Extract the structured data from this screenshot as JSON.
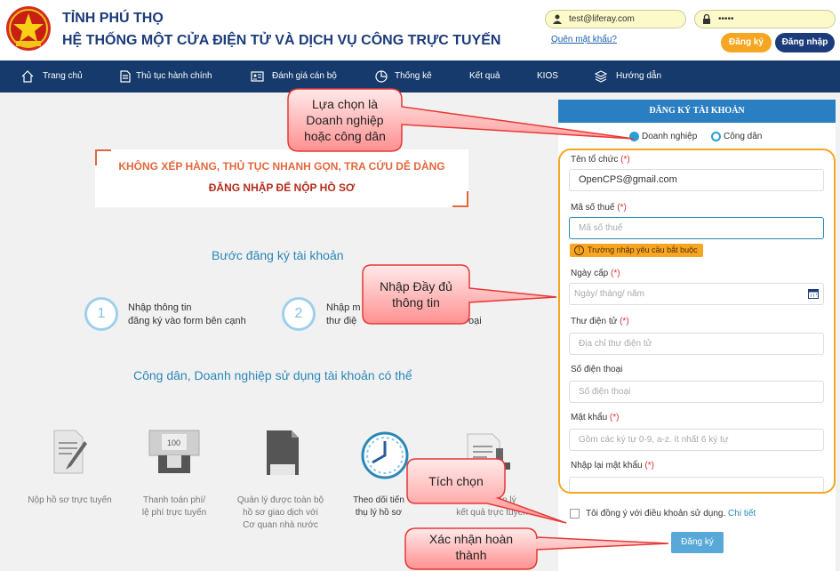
{
  "header": {
    "title1": "TỈNH PHÚ THỌ",
    "title2": "HỆ THỐNG MỘT CỬA ĐIỆN TỬ VÀ DỊCH VỤ CÔNG TRỰC TUYẾN",
    "email_value": "test@liferay.com",
    "password_value": "•••••",
    "forgot": "Quên mật khẩu?",
    "register": "Đăng ký",
    "login": "Đăng nhập"
  },
  "nav": [
    "Trang chủ",
    "Thủ tục hành chính",
    "Đánh giá cán bộ",
    "Thống kê",
    "Kết quả",
    "KIOS",
    "Hướng dẫn"
  ],
  "banner": {
    "line1": "KHÔNG XẾP HÀNG, THỦ TỤC NHANH GỌN, TRA CỨU DỄ DÀNG",
    "line2": "ĐĂNG NHẬP ĐỂ NỘP HỒ SƠ"
  },
  "steps": {
    "title": "Bước đăng ký tài khoản",
    "s1_num": "1",
    "s1_l1": "Nhập thông tin",
    "s1_l2": "đăng ký vào form bên cạnh",
    "s2_num": "2",
    "s2_l1": "Nhập m",
    "s2_l2": "thư điệ",
    "s2_l3": "oại"
  },
  "uses": {
    "title": "Công dân, Doanh nghiệp sử dụng tài khoản có thể",
    "f1": "Nộp hồ sơ trực tuyến",
    "f2a": "Thanh toán phí/",
    "f2b": "lệ phí trực tuyến",
    "f3a": "Quản lý được toàn bộ",
    "f3b": "hồ sơ giao dịch với",
    "f3c": "Cơ quan nhà nước",
    "f4a": "Theo dõi tiến",
    "f4b": "thụ lý hồ sơ",
    "f5a": "a quản lý",
    "f5b": "kết quả trực tuyến",
    "bill": "100"
  },
  "form": {
    "title": "ĐĂNG KÝ TÀI KHOẢN",
    "radio1": "Doanh nghiệp",
    "radio2": "Công dân",
    "req": "(*)",
    "org_label": "Tên tổ chức",
    "org_value": "OpenCPS@gmail.com",
    "tax_label": "Mã số thuế",
    "tax_ph": "Mã số thuế",
    "tax_err": "Trường nhập yêu cầu bắt buộc",
    "date_label": "Ngày cấp",
    "date_ph": "Ngày/ tháng/ năm",
    "email_label": "Thư điện tử",
    "email_ph": "Địa chỉ thư điện tử",
    "phone_label": "Số điện thoại",
    "phone_ph": "Số điện thoại",
    "pw_label": "Mật khẩu",
    "pw_ph": "Gồm các ký tự 0-9, a-z. ít nhất 6 ký tự",
    "pw2_label": "Nhập lại mật khẩu",
    "agree": "Tôi đồng ý với điều khoản sử dụng.",
    "detail": "Chi tiết",
    "submit": "Đăng ký"
  },
  "callouts": {
    "c1a": "Lựa chọn là",
    "c1b": "Doanh nghiệp",
    "c1c": "hoặc công dân",
    "c2a": "Nhập Đầy đủ",
    "c2b": "thông tin",
    "c3": "Tích chọn",
    "c4a": "Xác nhận hoàn",
    "c4b": "thành"
  },
  "colors": {
    "navy": "#163a6b",
    "accent": "#2a7fc2",
    "orange": "#f5a623",
    "callout_red": "#e53935"
  }
}
